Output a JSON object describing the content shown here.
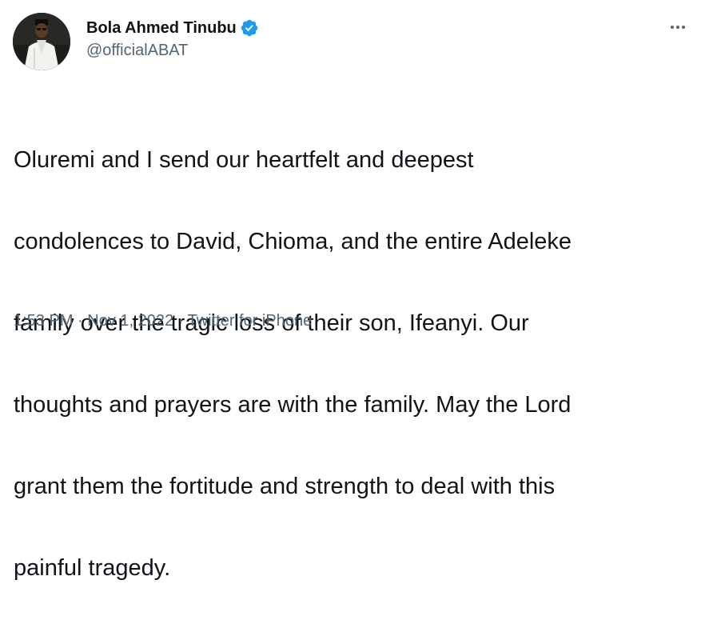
{
  "author": {
    "display_name": "Bola Ahmed Tinubu",
    "handle": "@officialABAT",
    "verified": true,
    "verified_color": "#1d9bf0"
  },
  "menu": {
    "icon": "more-horizontal-icon"
  },
  "tweet": {
    "text_lines": [
      "Oluremi and I send our heartfelt and deepest",
      "condolences to David, Chioma, and the entire Adeleke",
      "family over the tragic loss of their son, Ifeanyi. Our",
      "thoughts and prayers are with the family. May the Lord",
      "grant them the fortitude and strength to deal with this",
      "painful tragedy."
    ]
  },
  "meta": {
    "time": "1:53 PM",
    "separator": "·",
    "date": "Nov 1, 2022",
    "source": "Twitter for iPhone"
  },
  "colors": {
    "text_primary": "#0f1419",
    "text_secondary": "#536471",
    "background": "#ffffff"
  }
}
